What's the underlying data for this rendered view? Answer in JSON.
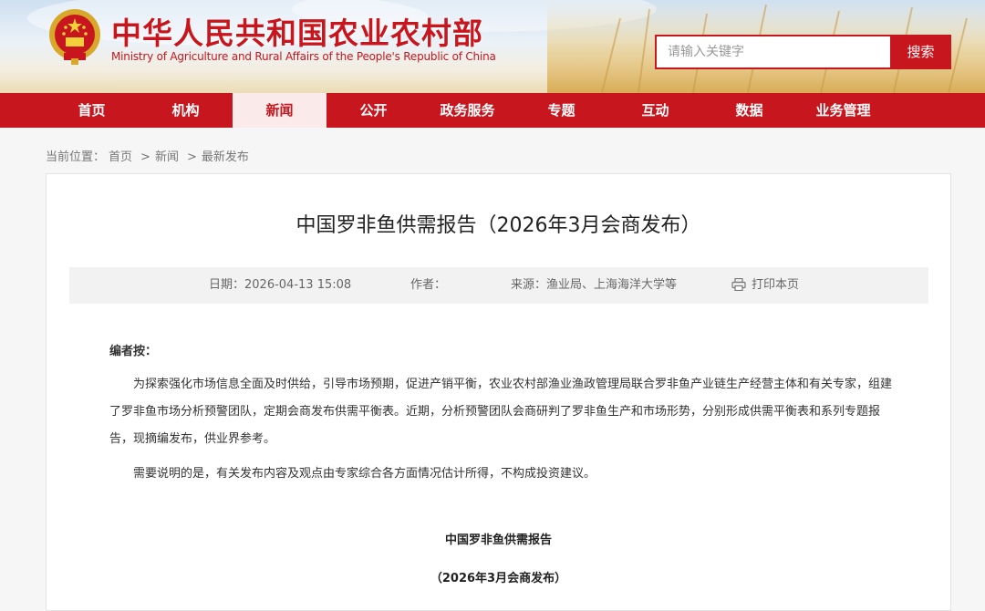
{
  "header": {
    "title_cn": "中华人民共和国农业农村部",
    "title_en": "Ministry of Agriculture and Rural Affairs of the People's Republic of China",
    "search_placeholder": "请输入关键字",
    "search_button": "搜索",
    "emblem_icon": "national-emblem-icon"
  },
  "nav": {
    "items": [
      {
        "label": "首页"
      },
      {
        "label": "机构"
      },
      {
        "label": "新闻"
      },
      {
        "label": "公开"
      },
      {
        "label": "政务服务"
      },
      {
        "label": "专题"
      },
      {
        "label": "互动"
      },
      {
        "label": "数据"
      },
      {
        "label": "业务管理"
      }
    ],
    "active_index": 2
  },
  "breadcrumb": {
    "prefix": "当前位置：",
    "items": [
      "首页",
      "新闻",
      "最新发布"
    ],
    "separator": ">"
  },
  "article": {
    "title": "中国罗非鱼供需报告（2026年3月会商发布）",
    "meta": {
      "date_label": "日期：",
      "date_value": "2026-04-13 15:08",
      "author_label": "作者：",
      "author_value": "",
      "source_label": "来源：",
      "source_value": "渔业局、上海海洋大学等",
      "print_label": "打印本页",
      "print_icon": "printer-icon"
    },
    "editor_note_label": "编者按：",
    "paragraphs": [
      "为探索强化市场信息全面及时供给，引导市场预期，促进产销平衡，农业农村部渔业渔政管理局联合罗非鱼产业链生产经营主体和有关专家，组建了罗非鱼市场分析预警团队，定期会商发布供需平衡表。近期，分析预警团队会商研判了罗非鱼生产和市场形势，分别形成供需平衡表和系列专题报告，现摘编发布，供业界参考。",
      "需要说明的是，有关发布内容及观点由专家综合各方面情况估计所得，不构成投资建议。"
    ],
    "report_title": "中国罗非鱼供需报告",
    "report_subtitle": "（2026年3月会商发布）"
  },
  "colors": {
    "brand_red": "#c8161e",
    "nav_active_bg": "#fbeaea",
    "meta_bg": "#f2f2f2"
  }
}
